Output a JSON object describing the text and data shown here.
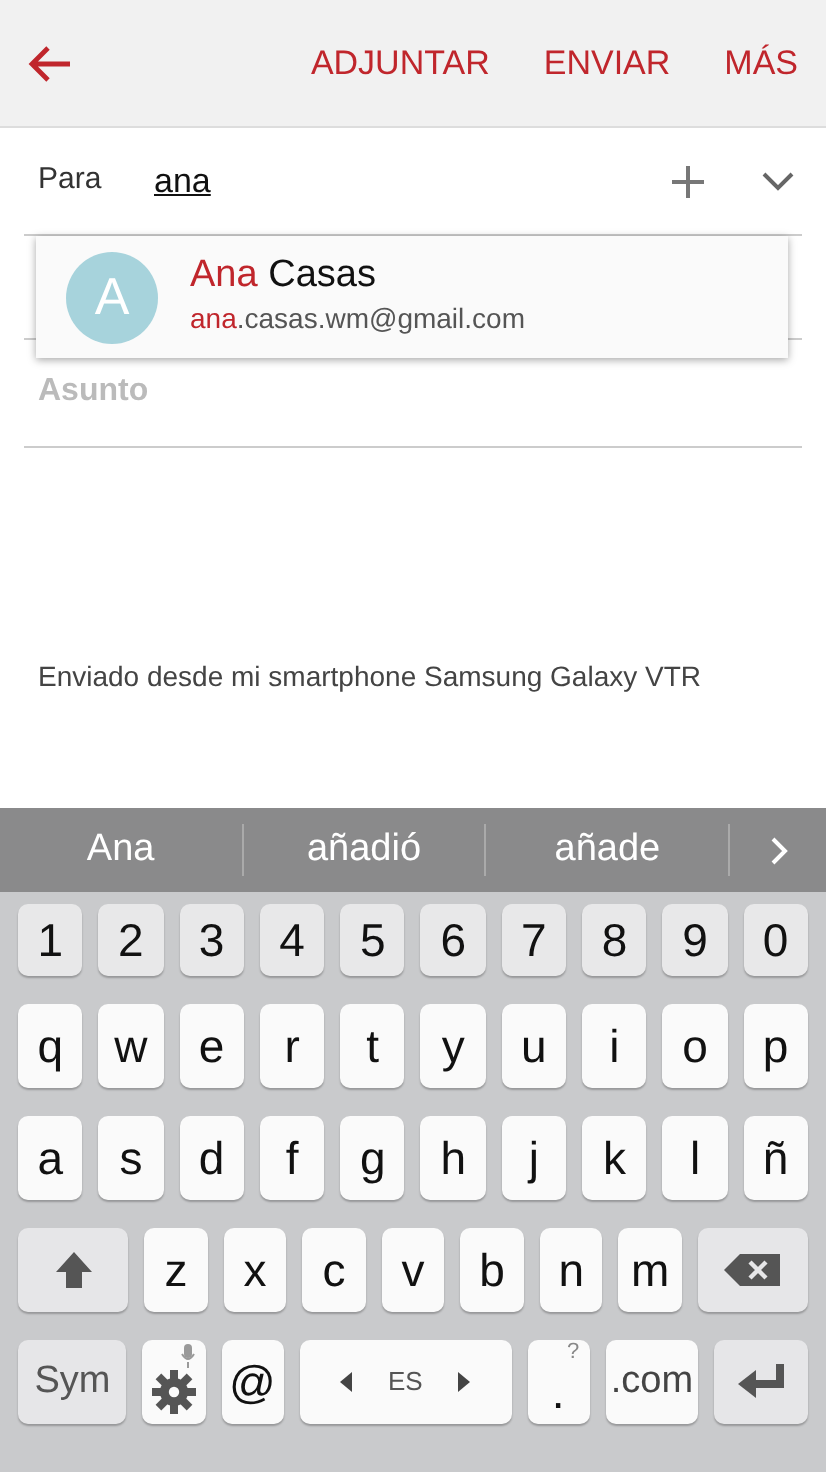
{
  "toolbar": {
    "actions": [
      "ADJUNTAR",
      "ENVIAR",
      "MÁS"
    ]
  },
  "to_field": {
    "label": "Para",
    "value": "ana"
  },
  "suggestion": {
    "initial": "A",
    "name_match": "Ana",
    "name_rest": " Casas",
    "email_match": "ana",
    "email_rest": ".casas.wm@gmail.com"
  },
  "subject": {
    "placeholder": "Asunto"
  },
  "signature": "Enviado desde mi smartphone Samsung Galaxy VTR",
  "keyboard": {
    "suggestions": [
      "Ana",
      "añadió",
      "añade"
    ],
    "rows": [
      [
        {
          "kind": "num",
          "label": "1"
        },
        {
          "kind": "num",
          "label": "2"
        },
        {
          "kind": "num",
          "label": "3"
        },
        {
          "kind": "num",
          "label": "4"
        },
        {
          "kind": "num",
          "label": "5"
        },
        {
          "kind": "num",
          "label": "6"
        },
        {
          "kind": "num",
          "label": "7"
        },
        {
          "kind": "num",
          "label": "8"
        },
        {
          "kind": "num",
          "label": "9"
        },
        {
          "kind": "num",
          "label": "0"
        }
      ],
      [
        {
          "kind": "char",
          "label": "q"
        },
        {
          "kind": "char",
          "label": "w"
        },
        {
          "kind": "char",
          "label": "e"
        },
        {
          "kind": "char",
          "label": "r"
        },
        {
          "kind": "char",
          "label": "t"
        },
        {
          "kind": "char",
          "label": "y"
        },
        {
          "kind": "char",
          "label": "u"
        },
        {
          "kind": "char",
          "label": "i"
        },
        {
          "kind": "char",
          "label": "o"
        },
        {
          "kind": "char",
          "label": "p"
        }
      ],
      [
        {
          "kind": "char",
          "label": "a"
        },
        {
          "kind": "char",
          "label": "s"
        },
        {
          "kind": "char",
          "label": "d"
        },
        {
          "kind": "char",
          "label": "f"
        },
        {
          "kind": "char",
          "label": "g"
        },
        {
          "kind": "char",
          "label": "h"
        },
        {
          "kind": "char",
          "label": "j"
        },
        {
          "kind": "char",
          "label": "k"
        },
        {
          "kind": "char",
          "label": "l"
        },
        {
          "kind": "char",
          "label": "ñ"
        }
      ],
      [
        {
          "kind": "shift"
        },
        {
          "kind": "char",
          "label": "z"
        },
        {
          "kind": "char",
          "label": "x"
        },
        {
          "kind": "char",
          "label": "c"
        },
        {
          "kind": "char",
          "label": "v"
        },
        {
          "kind": "char",
          "label": "b"
        },
        {
          "kind": "char",
          "label": "n"
        },
        {
          "kind": "char",
          "label": "m"
        },
        {
          "kind": "backspace"
        }
      ],
      [
        {
          "kind": "sym",
          "label": "Sym"
        },
        {
          "kind": "settings"
        },
        {
          "kind": "char",
          "label": "@"
        },
        {
          "kind": "space",
          "label": "ES"
        },
        {
          "kind": "period",
          "label": ".",
          "hint": "?"
        },
        {
          "kind": "domain",
          "label": ".com"
        },
        {
          "kind": "enter"
        }
      ]
    ]
  }
}
